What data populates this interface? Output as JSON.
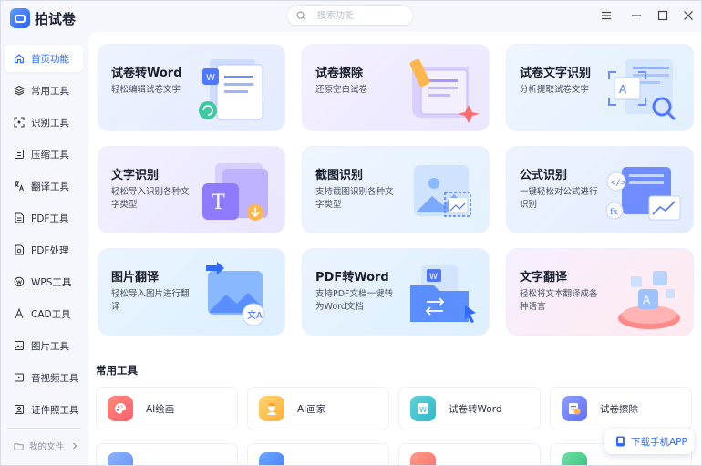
{
  "app": {
    "title": "拍试卷"
  },
  "search": {
    "placeholder": "搜索功能"
  },
  "sidebar": {
    "items": [
      {
        "label": "首页功能",
        "icon": "home-icon",
        "active": true
      },
      {
        "label": "常用工具",
        "icon": "layers-icon"
      },
      {
        "label": "识别工具",
        "icon": "scan-icon"
      },
      {
        "label": "压缩工具",
        "icon": "compress-icon"
      },
      {
        "label": "翻译工具",
        "icon": "translate-icon"
      },
      {
        "label": "PDF工具",
        "icon": "pdf-icon"
      },
      {
        "label": "PDF处理",
        "icon": "pdf-process-icon"
      },
      {
        "label": "WPS工具",
        "icon": "wps-icon"
      },
      {
        "label": "CAD工具",
        "icon": "cad-icon"
      },
      {
        "label": "图片工具",
        "icon": "image-icon"
      },
      {
        "label": "音视频工具",
        "icon": "video-icon"
      },
      {
        "label": "证件照工具",
        "icon": "id-photo-icon"
      }
    ],
    "footer": "我的文件"
  },
  "cards": [
    {
      "title": "试卷转Word",
      "desc": "轻松编辑试卷文字"
    },
    {
      "title": "试卷擦除",
      "desc": "还原空白试卷"
    },
    {
      "title": "试卷文字识别",
      "desc": "分析提取试卷文字"
    },
    {
      "title": "文字识别",
      "desc": "轻松导入识别各种文字类型"
    },
    {
      "title": "截图识别",
      "desc": "支持截图识别各种文字类型"
    },
    {
      "title": "公式识别",
      "desc": "一键轻松对公式进行识别"
    },
    {
      "title": "图片翻译",
      "desc": "轻松导入图片进行翻译"
    },
    {
      "title": "PDF转Word",
      "desc": "支持PDF文档一键转为Word文档"
    },
    {
      "title": "文字翻译",
      "desc": "轻松将文本翻译成各种语言"
    }
  ],
  "common_tools": {
    "title": "常用工具",
    "items": [
      {
        "label": "AI绘画"
      },
      {
        "label": "AI画家"
      },
      {
        "label": "试卷转Word"
      },
      {
        "label": "试卷擦除"
      }
    ]
  },
  "download": {
    "label": "下载手机APP"
  },
  "colors": {
    "accent": "#2f6bff",
    "sidebar_bg": "#f5f7fc"
  }
}
